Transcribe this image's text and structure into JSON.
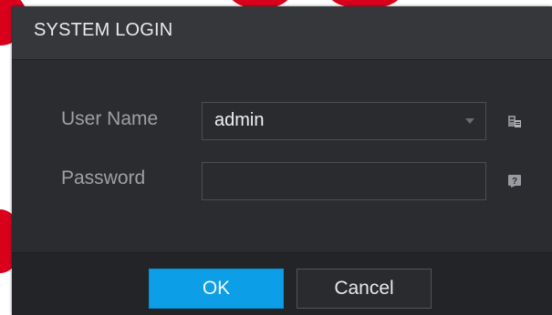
{
  "dialog": {
    "title": "SYSTEM LOGIN"
  },
  "form": {
    "username_label": "User Name",
    "username_value": "admin",
    "username_icon": "keyboard-icon",
    "password_label": "Password",
    "password_value": "",
    "password_icon": "password-hint-icon"
  },
  "footer": {
    "ok_label": "OK",
    "cancel_label": "Cancel"
  },
  "colors": {
    "ok_button": "#0d9ee8",
    "dialog_background": "#2d2e32",
    "watermark": "#d9001c"
  }
}
